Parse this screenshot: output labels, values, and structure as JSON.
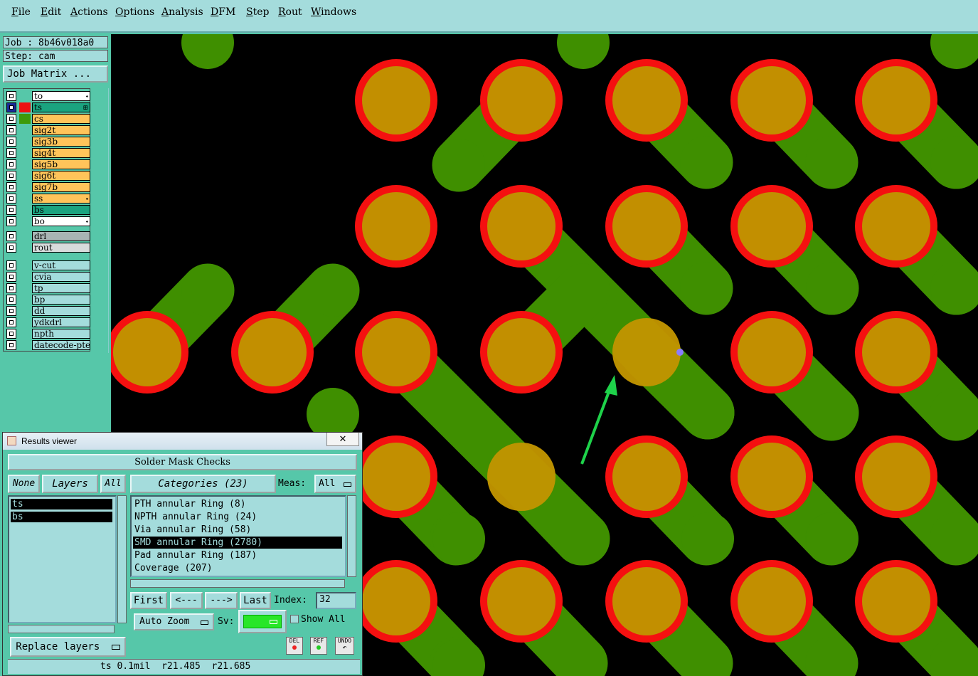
{
  "menu": [
    "File",
    "Edit",
    "Actions",
    "Options",
    "Analysis",
    "DFM",
    "Step",
    "Rout",
    "Windows"
  ],
  "job": {
    "job_label": "Job : 8b46v018a0",
    "step_label": "Step: cam",
    "matrix_button": "Job Matrix ..."
  },
  "layers": [
    {
      "name": "to",
      "color": "#ffffff",
      "swatch": "",
      "mark": "⬩"
    },
    {
      "name": "ts",
      "color": "#1aa37f",
      "swatch": "#ee1111",
      "mark": "⊞"
    },
    {
      "name": "cs",
      "color": "#ffc45a",
      "swatch": "#3d9a0a",
      "mark": ""
    },
    {
      "name": "sig2t",
      "color": "#ffc45a",
      "swatch": "",
      "mark": ""
    },
    {
      "name": "sig3b",
      "color": "#ffc45a",
      "swatch": "",
      "mark": ""
    },
    {
      "name": "sig4t",
      "color": "#ffc45a",
      "swatch": "",
      "mark": ""
    },
    {
      "name": "sig5b",
      "color": "#ffc45a",
      "swatch": "",
      "mark": ""
    },
    {
      "name": "sig6t",
      "color": "#ffc45a",
      "swatch": "",
      "mark": ""
    },
    {
      "name": "sig7b",
      "color": "#ffc45a",
      "swatch": "",
      "mark": ""
    },
    {
      "name": "ss",
      "color": "#ffc45a",
      "swatch": "",
      "mark": "⬩"
    },
    {
      "name": "bs",
      "color": "#1aa37f",
      "swatch": "",
      "mark": ""
    },
    {
      "name": "bo",
      "color": "#ffffff",
      "swatch": "",
      "mark": "⬩"
    }
  ],
  "drill_layers": [
    {
      "name": "drl",
      "color": "#a8b4b4"
    },
    {
      "name": "rout",
      "color": "#d8dcdc"
    }
  ],
  "misc_layers": [
    {
      "name": "v-cut",
      "color": "#a4dcdc"
    },
    {
      "name": "cvia",
      "color": "#a4dcdc"
    },
    {
      "name": "tp",
      "color": "#a4dcdc"
    },
    {
      "name": "bp",
      "color": "#a4dcdc"
    },
    {
      "name": "dd",
      "color": "#a4dcdc"
    },
    {
      "name": "ydkdrl",
      "color": "#a4dcdc"
    },
    {
      "name": "npth",
      "color": "#a4dcdc"
    },
    {
      "name": "datecode-pte",
      "color": "#a4dcdc"
    }
  ],
  "results": {
    "window_title": "Results viewer",
    "close_glyph": "✕",
    "header": "Solder Mask Checks",
    "none_btn": "None",
    "layers_btn": "Layers",
    "all_btn": "All",
    "layer_items": [
      "ts",
      "bs"
    ],
    "categories_btn": "Categories (23)",
    "meas_label": "Meas:",
    "meas_value": "All",
    "categories": [
      "PTH annular Ring (8)",
      "NPTH annular Ring (24)",
      "Via annular Ring (58)",
      "SMD annular Ring (2780)",
      "Pad annular Ring (187)",
      "Coverage (207)"
    ],
    "selected_category": 3,
    "first_btn": "First",
    "prev_btn": "<---",
    "next_btn": "--->",
    "last_btn": "Last",
    "index_label": "Index:",
    "index_value": "32",
    "auto_zoom": "Auto Zoom",
    "sv_label": "Sv:",
    "show_all": "Show All",
    "replace_layers": "Replace layers",
    "del": "DEL",
    "ref": "REF",
    "undo": "UNDO",
    "status": "ts 0.1mil  r21.485  r21.685"
  },
  "colors": {
    "pad_ring": "#f51010",
    "pad_fill": "#c09400",
    "trace": "#3f8f00",
    "arrow": "#1ed24a",
    "background": "#000000"
  }
}
